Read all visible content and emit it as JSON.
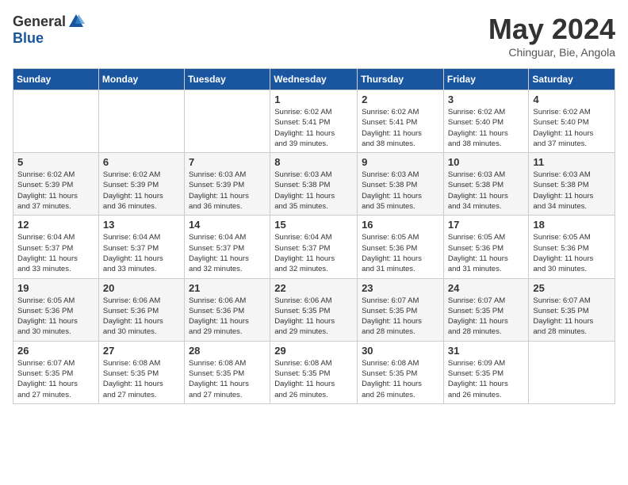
{
  "logo": {
    "general": "General",
    "blue": "Blue"
  },
  "title": "May 2024",
  "location": "Chinguar, Bie, Angola",
  "days_of_week": [
    "Sunday",
    "Monday",
    "Tuesday",
    "Wednesday",
    "Thursday",
    "Friday",
    "Saturday"
  ],
  "weeks": [
    [
      {
        "day": "",
        "info": ""
      },
      {
        "day": "",
        "info": ""
      },
      {
        "day": "",
        "info": ""
      },
      {
        "day": "1",
        "info": "Sunrise: 6:02 AM\nSunset: 5:41 PM\nDaylight: 11 hours\nand 39 minutes."
      },
      {
        "day": "2",
        "info": "Sunrise: 6:02 AM\nSunset: 5:41 PM\nDaylight: 11 hours\nand 38 minutes."
      },
      {
        "day": "3",
        "info": "Sunrise: 6:02 AM\nSunset: 5:40 PM\nDaylight: 11 hours\nand 38 minutes."
      },
      {
        "day": "4",
        "info": "Sunrise: 6:02 AM\nSunset: 5:40 PM\nDaylight: 11 hours\nand 37 minutes."
      }
    ],
    [
      {
        "day": "5",
        "info": "Sunrise: 6:02 AM\nSunset: 5:39 PM\nDaylight: 11 hours\nand 37 minutes."
      },
      {
        "day": "6",
        "info": "Sunrise: 6:02 AM\nSunset: 5:39 PM\nDaylight: 11 hours\nand 36 minutes."
      },
      {
        "day": "7",
        "info": "Sunrise: 6:03 AM\nSunset: 5:39 PM\nDaylight: 11 hours\nand 36 minutes."
      },
      {
        "day": "8",
        "info": "Sunrise: 6:03 AM\nSunset: 5:38 PM\nDaylight: 11 hours\nand 35 minutes."
      },
      {
        "day": "9",
        "info": "Sunrise: 6:03 AM\nSunset: 5:38 PM\nDaylight: 11 hours\nand 35 minutes."
      },
      {
        "day": "10",
        "info": "Sunrise: 6:03 AM\nSunset: 5:38 PM\nDaylight: 11 hours\nand 34 minutes."
      },
      {
        "day": "11",
        "info": "Sunrise: 6:03 AM\nSunset: 5:38 PM\nDaylight: 11 hours\nand 34 minutes."
      }
    ],
    [
      {
        "day": "12",
        "info": "Sunrise: 6:04 AM\nSunset: 5:37 PM\nDaylight: 11 hours\nand 33 minutes."
      },
      {
        "day": "13",
        "info": "Sunrise: 6:04 AM\nSunset: 5:37 PM\nDaylight: 11 hours\nand 33 minutes."
      },
      {
        "day": "14",
        "info": "Sunrise: 6:04 AM\nSunset: 5:37 PM\nDaylight: 11 hours\nand 32 minutes."
      },
      {
        "day": "15",
        "info": "Sunrise: 6:04 AM\nSunset: 5:37 PM\nDaylight: 11 hours\nand 32 minutes."
      },
      {
        "day": "16",
        "info": "Sunrise: 6:05 AM\nSunset: 5:36 PM\nDaylight: 11 hours\nand 31 minutes."
      },
      {
        "day": "17",
        "info": "Sunrise: 6:05 AM\nSunset: 5:36 PM\nDaylight: 11 hours\nand 31 minutes."
      },
      {
        "day": "18",
        "info": "Sunrise: 6:05 AM\nSunset: 5:36 PM\nDaylight: 11 hours\nand 30 minutes."
      }
    ],
    [
      {
        "day": "19",
        "info": "Sunrise: 6:05 AM\nSunset: 5:36 PM\nDaylight: 11 hours\nand 30 minutes."
      },
      {
        "day": "20",
        "info": "Sunrise: 6:06 AM\nSunset: 5:36 PM\nDaylight: 11 hours\nand 30 minutes."
      },
      {
        "day": "21",
        "info": "Sunrise: 6:06 AM\nSunset: 5:36 PM\nDaylight: 11 hours\nand 29 minutes."
      },
      {
        "day": "22",
        "info": "Sunrise: 6:06 AM\nSunset: 5:35 PM\nDaylight: 11 hours\nand 29 minutes."
      },
      {
        "day": "23",
        "info": "Sunrise: 6:07 AM\nSunset: 5:35 PM\nDaylight: 11 hours\nand 28 minutes."
      },
      {
        "day": "24",
        "info": "Sunrise: 6:07 AM\nSunset: 5:35 PM\nDaylight: 11 hours\nand 28 minutes."
      },
      {
        "day": "25",
        "info": "Sunrise: 6:07 AM\nSunset: 5:35 PM\nDaylight: 11 hours\nand 28 minutes."
      }
    ],
    [
      {
        "day": "26",
        "info": "Sunrise: 6:07 AM\nSunset: 5:35 PM\nDaylight: 11 hours\nand 27 minutes."
      },
      {
        "day": "27",
        "info": "Sunrise: 6:08 AM\nSunset: 5:35 PM\nDaylight: 11 hours\nand 27 minutes."
      },
      {
        "day": "28",
        "info": "Sunrise: 6:08 AM\nSunset: 5:35 PM\nDaylight: 11 hours\nand 27 minutes."
      },
      {
        "day": "29",
        "info": "Sunrise: 6:08 AM\nSunset: 5:35 PM\nDaylight: 11 hours\nand 26 minutes."
      },
      {
        "day": "30",
        "info": "Sunrise: 6:08 AM\nSunset: 5:35 PM\nDaylight: 11 hours\nand 26 minutes."
      },
      {
        "day": "31",
        "info": "Sunrise: 6:09 AM\nSunset: 5:35 PM\nDaylight: 11 hours\nand 26 minutes."
      },
      {
        "day": "",
        "info": ""
      }
    ]
  ]
}
